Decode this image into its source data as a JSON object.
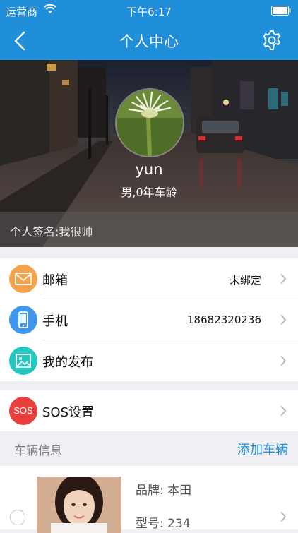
{
  "status_bar": {
    "carrier": "运营商",
    "time": "下午6:17"
  },
  "nav": {
    "title": "个人中心"
  },
  "profile": {
    "username": "yun",
    "gender_age": "男,0年车龄",
    "signature": "个人签名:我很帅"
  },
  "menu": [
    {
      "label": "邮箱",
      "value": "未绑定",
      "icon": "mail-icon",
      "color": "#f5a24a"
    },
    {
      "label": "手机",
      "value": "18682320236",
      "icon": "phone-icon",
      "color": "#3e97ea"
    },
    {
      "label": "我的发布",
      "value": "",
      "icon": "image-icon",
      "color": "#22c8c1"
    }
  ],
  "sos": {
    "label": "SOS设置",
    "icon_text": "SOS",
    "color": "#e8403d"
  },
  "vehicles_section": {
    "title": "车辆信息",
    "add_label": "添加车辆"
  },
  "vehicle": {
    "brand": "品牌: 本田",
    "model": "型号: 234"
  },
  "colors": {
    "primary": "#1e8fd8",
    "background": "#efeff4"
  }
}
